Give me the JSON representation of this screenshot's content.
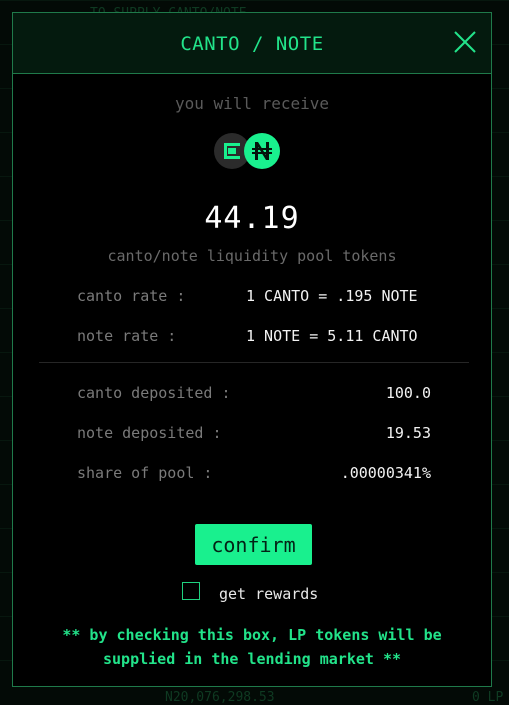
{
  "modal": {
    "title": "CANTO / NOTE",
    "receive_label": "you will receive",
    "amount": "44.19",
    "pool_label": "canto/note liquidity pool tokens",
    "token_icons": [
      "canto-icon",
      "note-icon"
    ],
    "rates": [
      {
        "label": "canto rate :",
        "value": "1 CANTO = .195 NOTE"
      },
      {
        "label": "note rate :",
        "value": "1 NOTE = 5.11 CANTO"
      }
    ],
    "details": [
      {
        "label": "canto deposited :",
        "value": "100.0"
      },
      {
        "label": "note deposited :",
        "value": "19.53"
      },
      {
        "label": "share of pool :",
        "value": ".00000341%"
      }
    ],
    "confirm_label": "confirm",
    "checkbox": {
      "label": "get rewards",
      "checked": false
    },
    "note_line1": "** by checking this box, LP tokens will be",
    "note_line2": "supplied in the lending market **"
  },
  "background": {
    "faint_text_top": "TO SUPPLY CANTO/NOTE",
    "faint_text_bottom_value": "N20,076,298.53",
    "faint_text_bottom_unit": "0 LP"
  },
  "colors": {
    "accent": "#19f08e",
    "title": "#22e38a",
    "modal_bg": "#000000",
    "border": "#1f7a4a"
  }
}
